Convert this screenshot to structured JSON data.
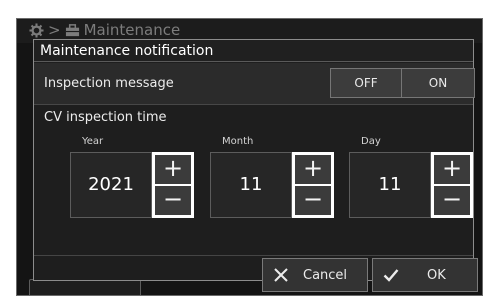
{
  "background": {
    "breadcrumb_label": "Maintenance"
  },
  "dialog": {
    "title": "Maintenance notification",
    "inspection_message": {
      "label": "Inspection message",
      "off_label": "OFF",
      "on_label": "ON"
    },
    "cv_inspection": {
      "label": "CV inspection time",
      "fields": [
        {
          "label": "Year",
          "value": "2021"
        },
        {
          "label": "Month",
          "value": "11"
        },
        {
          "label": "Day",
          "value": "11"
        }
      ],
      "increment_symbol": "+",
      "decrement_symbol": "−"
    },
    "cancel_label": "Cancel",
    "ok_label": "OK"
  },
  "colors": {
    "dialog_bg": "#1e1e1e",
    "button_bg": "#333333",
    "stepper_highlight": "#ffffff"
  }
}
